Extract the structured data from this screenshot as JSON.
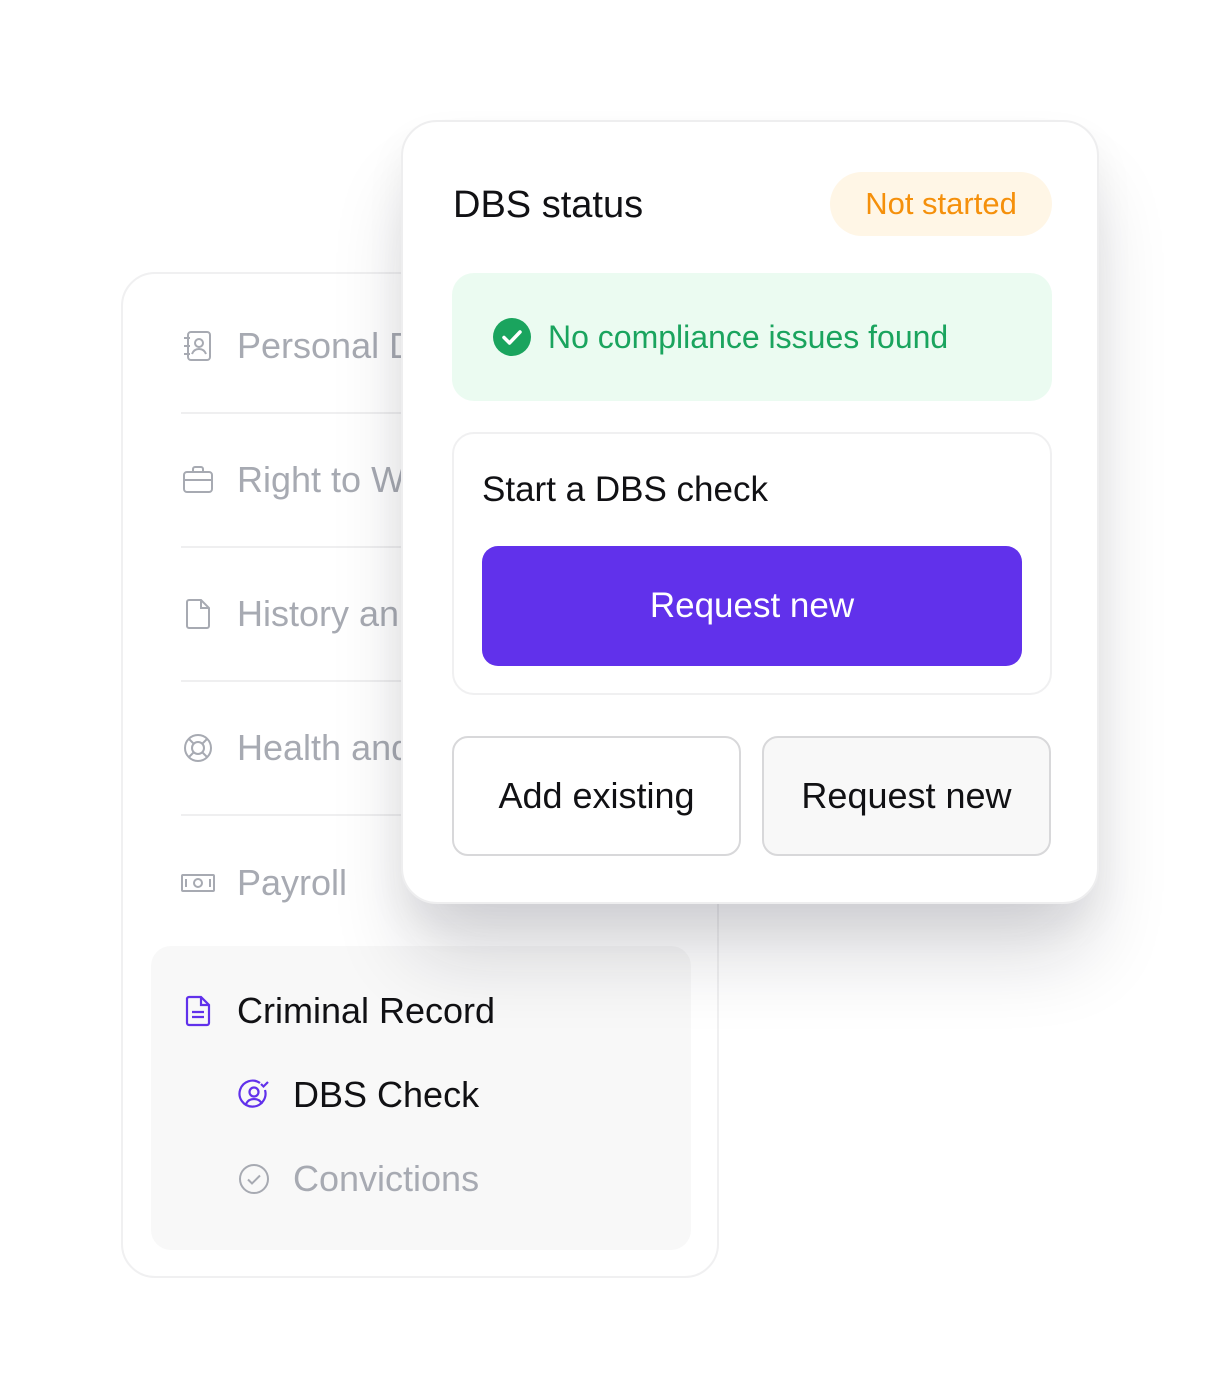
{
  "sidebar": {
    "items": [
      {
        "label": "Personal D",
        "icon": "contact-book-icon"
      },
      {
        "label": "Right to W",
        "icon": "briefcase-icon"
      },
      {
        "label": "History an",
        "icon": "document-icon"
      },
      {
        "label": "Health and",
        "icon": "lifebuoy-icon"
      },
      {
        "label": "Payroll",
        "icon": "banknote-icon"
      }
    ],
    "group": {
      "label": "Criminal Record",
      "icon": "file-text-icon",
      "children": [
        {
          "label": "DBS Check",
          "icon": "user-check-icon"
        },
        {
          "label": "Convictions",
          "icon": "check-circle-icon"
        }
      ]
    }
  },
  "popup": {
    "title": "DBS status",
    "status_badge": "Not started",
    "banner_text": "No compliance issues found",
    "start_title": "Start a DBS check",
    "primary_button": "Request new",
    "add_existing_button": "Add existing",
    "request_new_button": "Request new"
  },
  "colors": {
    "accent": "#6131eb",
    "success": "#1aa45e",
    "warning": "#f5900b",
    "muted_text": "#a7aab2"
  }
}
